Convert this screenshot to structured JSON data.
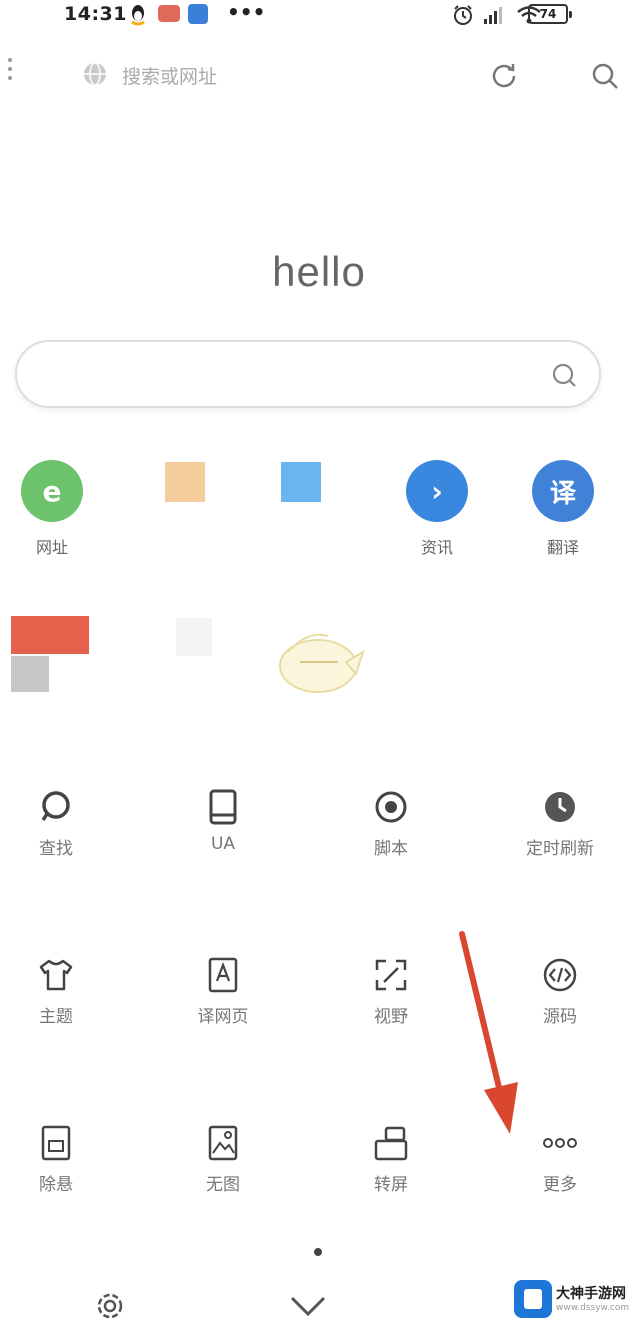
{
  "status_bar": {
    "time": "14:31",
    "battery": "74",
    "more": "•••"
  },
  "top_bar": {
    "address_placeholder": "搜索或网址"
  },
  "home": {
    "greeting": "hello"
  },
  "shortcuts": [
    {
      "label": "网址",
      "icon": "e-icon",
      "glyph": "e",
      "color": "#6cc36c"
    },
    {
      "label": "",
      "icon": "orange-square-icon",
      "color": "#f5cc9c"
    },
    {
      "label": "",
      "icon": "blue-square-icon",
      "color": "#6ab4ef"
    },
    {
      "label": "资讯",
      "icon": "news-icon",
      "glyph": "›",
      "color": "#3a87e0"
    },
    {
      "label": "翻译",
      "icon": "translate-icon",
      "glyph": "译",
      "color": "#3f82d7"
    }
  ],
  "tools": [
    {
      "label": "查找",
      "icon": "find-icon"
    },
    {
      "label": "UA",
      "icon": "ua-icon"
    },
    {
      "label": "脚本",
      "icon": "script-icon"
    },
    {
      "label": "定时刷新",
      "icon": "timer-refresh-icon"
    },
    {
      "label": "主题",
      "icon": "theme-icon"
    },
    {
      "label": "译网页",
      "icon": "translate-page-icon"
    },
    {
      "label": "视野",
      "icon": "view-icon"
    },
    {
      "label": "源码",
      "icon": "source-code-icon"
    },
    {
      "label": "除悬",
      "icon": "remove-float-icon"
    },
    {
      "label": "无图",
      "icon": "no-image-icon"
    },
    {
      "label": "转屏",
      "icon": "rotate-screen-icon"
    },
    {
      "label": "更多",
      "icon": "more-icon"
    }
  ],
  "watermark": {
    "title": "大神手游网",
    "subtitle": "www.dssyw.com"
  },
  "colors": {
    "annotation_arrow": "#d9472e",
    "tile_red": "#e6614b",
    "tile_gray": "#c6c6c6"
  }
}
